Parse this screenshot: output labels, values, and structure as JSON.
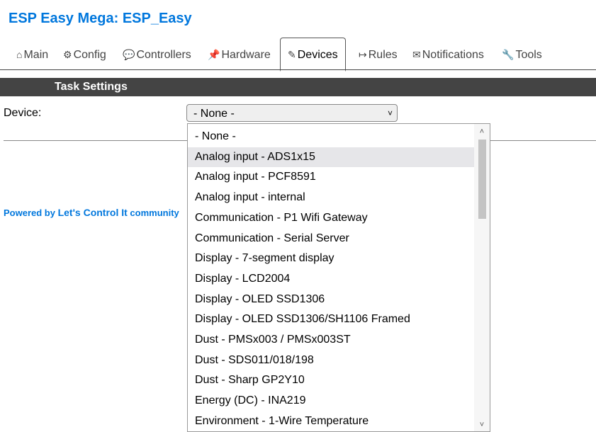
{
  "header": {
    "title": "ESP Easy Mega: ESP_Easy"
  },
  "tabs": [
    {
      "icon": "⌂",
      "label": "Main"
    },
    {
      "icon": "⚙",
      "label": "Config"
    },
    {
      "icon": "💬",
      "label": "Controllers"
    },
    {
      "icon": "📌",
      "label": "Hardware"
    },
    {
      "icon": "✎",
      "label": "Devices"
    },
    {
      "icon": "↦",
      "label": "Rules"
    },
    {
      "icon": "✉",
      "label": "Notifications"
    },
    {
      "icon": "🔧",
      "label": "Tools"
    }
  ],
  "active_tab": "Devices",
  "section": {
    "title": "Task Settings"
  },
  "form": {
    "device_label": "Device:",
    "device_selected": "- None -"
  },
  "footer": {
    "prefix": "Powered by ",
    "link": "Let's Control It",
    "suffix": " community"
  },
  "dropdown": {
    "highlighted_index": 1,
    "options": [
      "- None -",
      "Analog input - ADS1x15",
      "Analog input - PCF8591",
      "Analog input - internal",
      "Communication - P1 Wifi Gateway",
      "Communication - Serial Server",
      "Display - 7-segment display",
      "Display - LCD2004",
      "Display - OLED SSD1306",
      "Display - OLED SSD1306/SH1106 Framed",
      "Dust - PMSx003 / PMSx003ST",
      "Dust - SDS011/018/198",
      "Dust - Sharp GP2Y10",
      "Energy (DC) - INA219",
      "Environment - 1-Wire Temperature"
    ]
  },
  "colors": {
    "accent": "#0077DD",
    "bar": "#444444"
  }
}
